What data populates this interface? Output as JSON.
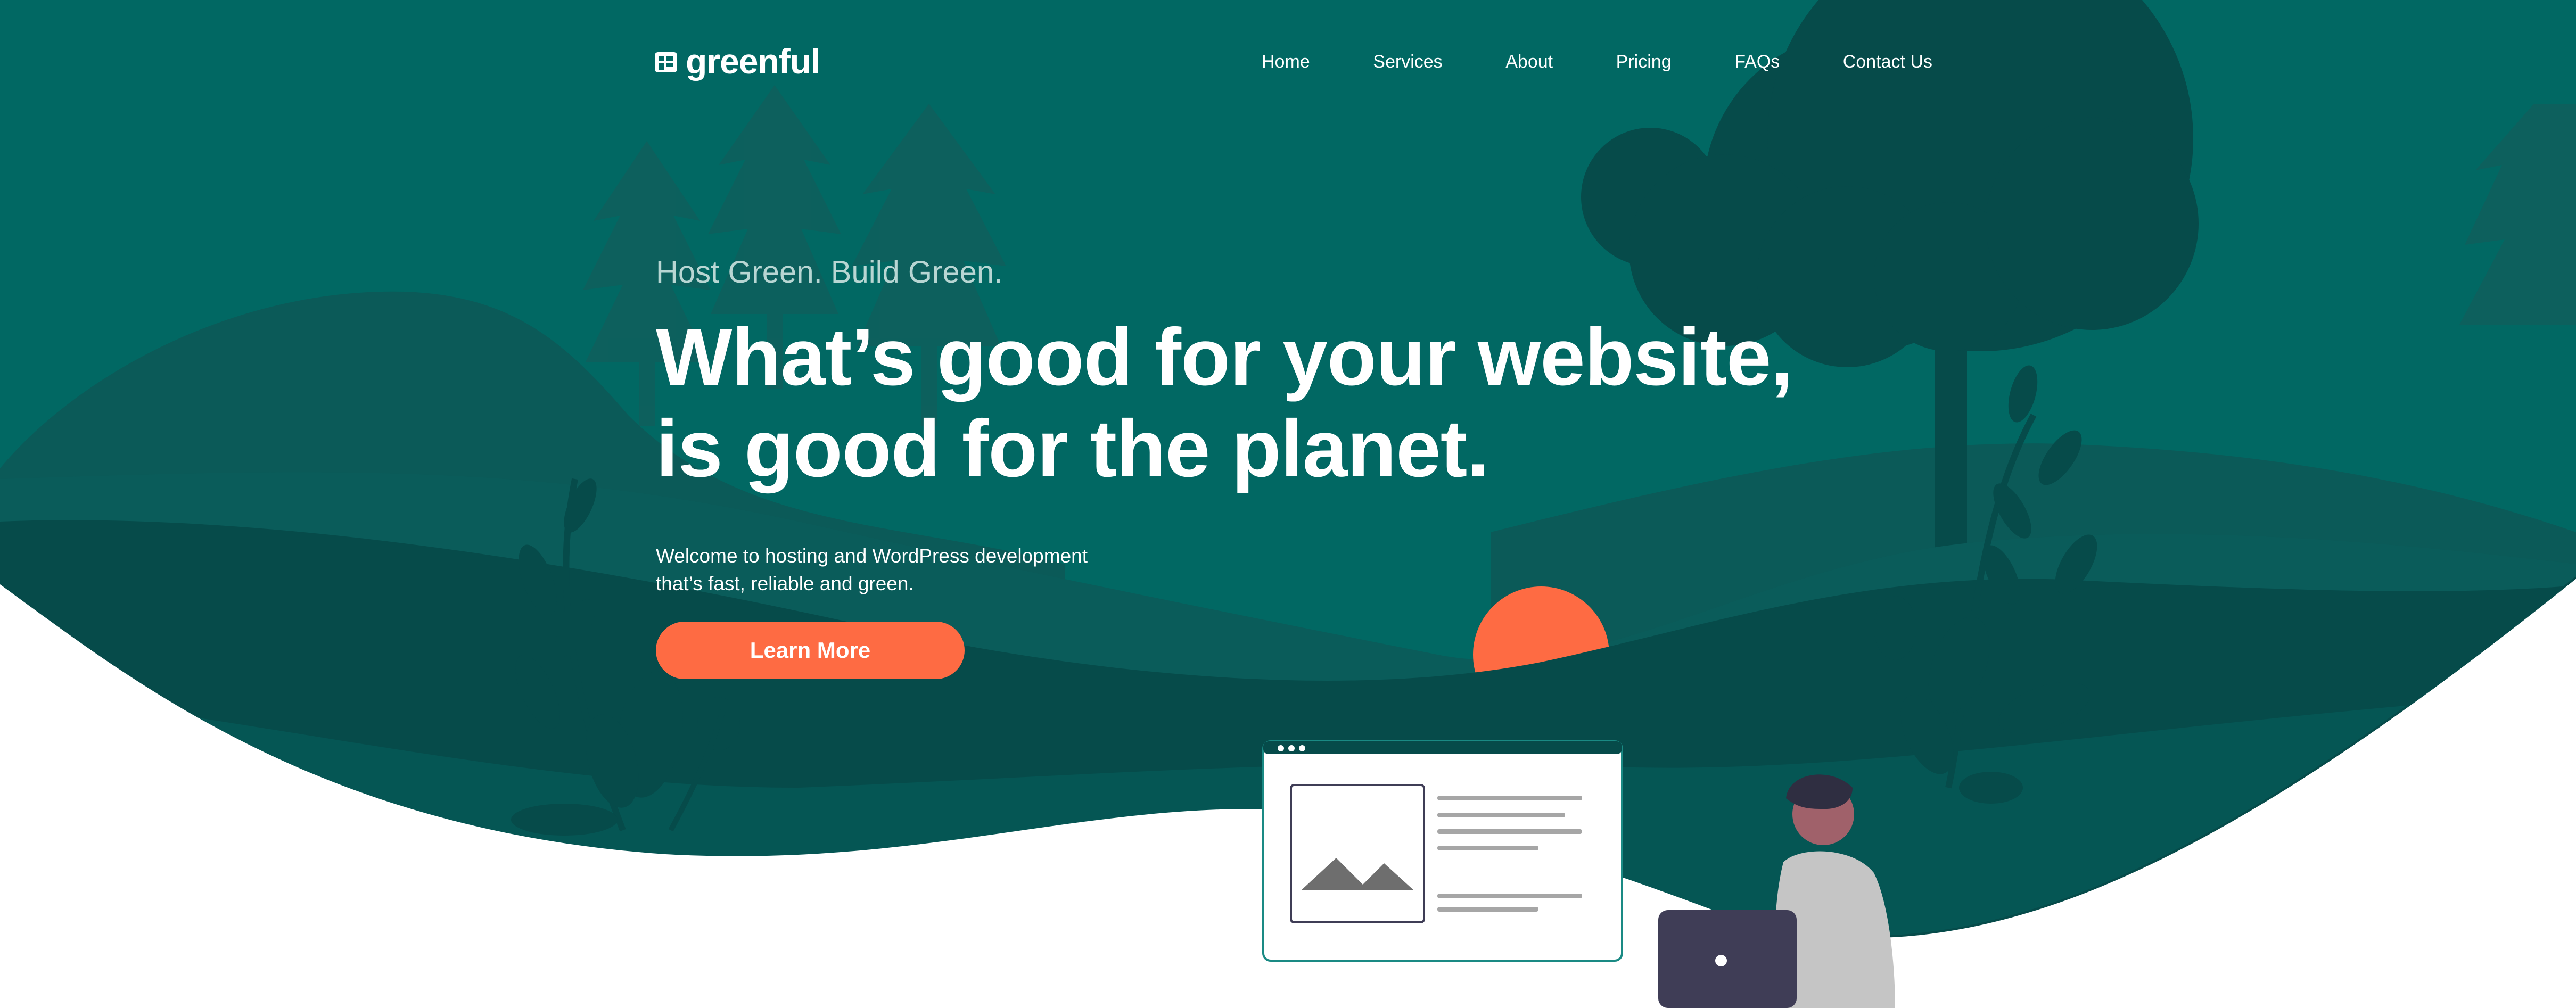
{
  "brand": {
    "name": "greenful",
    "logo_icon": "building-logo-icon"
  },
  "nav": {
    "items": [
      {
        "label": "Home"
      },
      {
        "label": "Services"
      },
      {
        "label": "About"
      },
      {
        "label": "Pricing"
      },
      {
        "label": "FAQs"
      },
      {
        "label": "Contact Us"
      }
    ]
  },
  "hero": {
    "eyebrow": "Host Green. Build Green.",
    "headline_line1": "What’s good for your website,",
    "headline_line2": "is good for the planet.",
    "intro_line1": "Welcome to hosting and WordPress development",
    "intro_line2": "that’s fast, reliable and green.",
    "cta_label": "Learn More"
  },
  "colors": {
    "background_teal": "#016863",
    "dark_teal": "#064b4a",
    "mid_teal": "#0a5c5a",
    "accent_orange": "#fe6b43",
    "white": "#ffffff"
  }
}
